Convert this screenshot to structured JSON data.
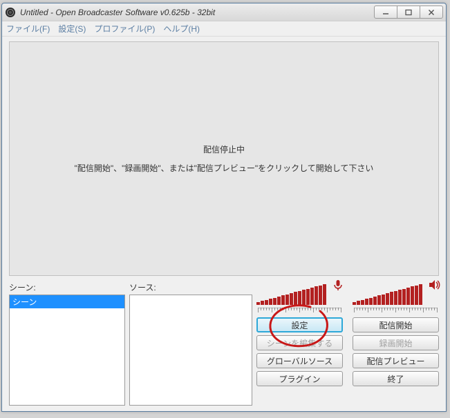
{
  "window": {
    "title": "Untitled - Open Broadcaster Software v0.625b - 32bit"
  },
  "menu": {
    "file": "ファイル(F)",
    "settings": "設定(S)",
    "profile": "プロファイル(P)",
    "help": "ヘルプ(H)"
  },
  "preview": {
    "status": "配信停止中",
    "hint": "\"配信開始\"、\"録画開始\"、または\"配信プレビュー\"をクリックして開始して下さい"
  },
  "panels": {
    "scenes_label": "シーン:",
    "sources_label": "ソース:",
    "scene_items": [
      "シーン"
    ]
  },
  "buttons": {
    "settings": "設定",
    "start_stream": "配信開始",
    "edit_scene": "シーンを編集する",
    "start_record": "録画開始",
    "global_sources": "グローバルソース",
    "preview_stream": "配信プレビュー",
    "plugins": "プラグイン",
    "exit": "終了"
  },
  "meters": {
    "mic_icon": "microphone-icon",
    "speaker_icon": "speaker-icon",
    "color": "#b32020"
  }
}
